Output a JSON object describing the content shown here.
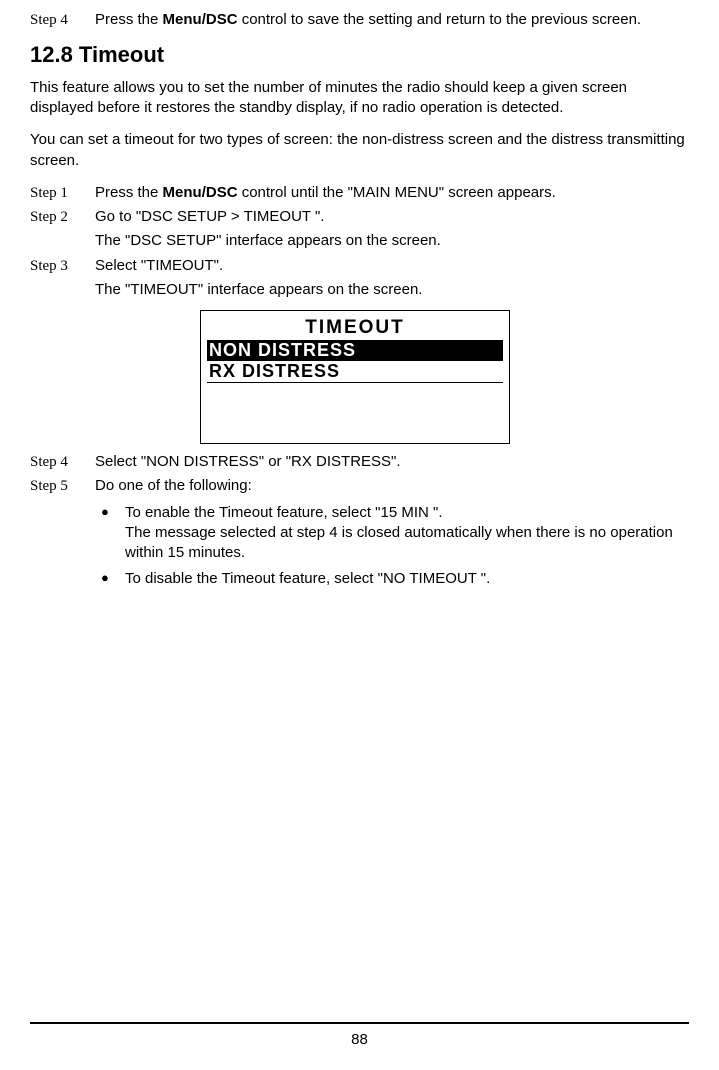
{
  "top_step": {
    "label": "Step 4",
    "text_a": "Press the ",
    "bold": "Menu/DSC",
    "text_b": " control to save the setting and return to the previous screen."
  },
  "heading": "12.8 Timeout",
  "intro_p1": "This feature allows you to set the number of minutes the radio should keep a given screen displayed before it restores the standby display, if no radio operation is detected.",
  "intro_p2": "You can set a timeout for two types of screen: the non-distress screen and the distress transmitting screen.",
  "steps": {
    "s1": {
      "label": "Step 1",
      "text_a": "Press the ",
      "bold": "Menu/DSC",
      "text_b": " control until the \"MAIN MENU\" screen appears."
    },
    "s2": {
      "label": "Step 2",
      "text": "Go to \"DSC SETUP > TIMEOUT \".",
      "sub": "The \"DSC SETUP\" interface appears on the screen."
    },
    "s3": {
      "label": "Step 3",
      "text": "Select \"TIMEOUT\".",
      "sub": "The \"TIMEOUT\" interface appears on the screen."
    },
    "s4": {
      "label": "Step 4",
      "text": "Select \"NON DISTRESS\" or \"RX DISTRESS\"."
    },
    "s5": {
      "label": "Step 5",
      "text": "Do one of the following:"
    }
  },
  "lcd": {
    "title": "TIMEOUT",
    "row1": "NON DISTRESS",
    "row2": "RX DISTRESS"
  },
  "bullets": {
    "b1_line1": "To enable the Timeout feature, select \"15 MIN \".",
    "b1_line2": "The message selected at step 4 is closed automatically when there is no operation within 15 minutes.",
    "b2": "To disable the Timeout feature, select \"NO TIMEOUT \"."
  },
  "page_number": "88"
}
